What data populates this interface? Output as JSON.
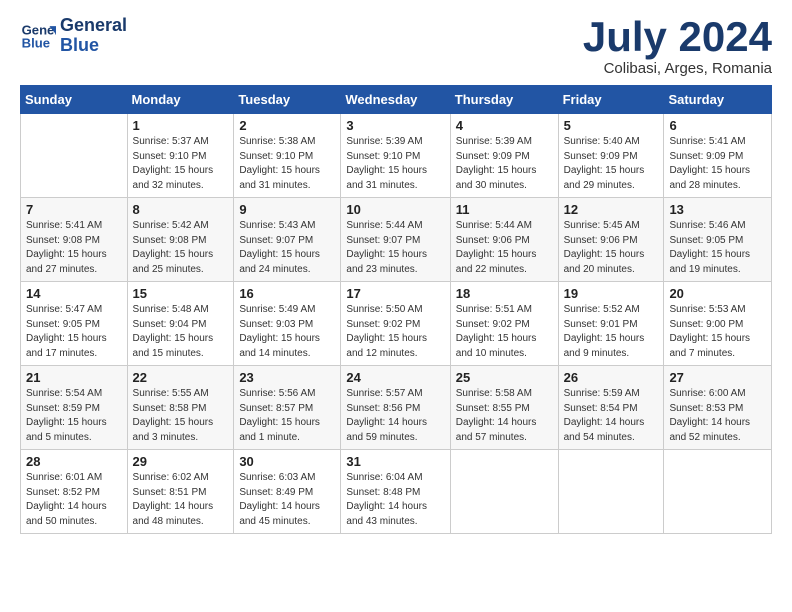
{
  "logo": {
    "line1": "General",
    "line2": "Blue"
  },
  "title": "July 2024",
  "subtitle": "Colibasi, Arges, Romania",
  "weekdays": [
    "Sunday",
    "Monday",
    "Tuesday",
    "Wednesday",
    "Thursday",
    "Friday",
    "Saturday"
  ],
  "weeks": [
    [
      {
        "day": "",
        "info": ""
      },
      {
        "day": "1",
        "info": "Sunrise: 5:37 AM\nSunset: 9:10 PM\nDaylight: 15 hours\nand 32 minutes."
      },
      {
        "day": "2",
        "info": "Sunrise: 5:38 AM\nSunset: 9:10 PM\nDaylight: 15 hours\nand 31 minutes."
      },
      {
        "day": "3",
        "info": "Sunrise: 5:39 AM\nSunset: 9:10 PM\nDaylight: 15 hours\nand 31 minutes."
      },
      {
        "day": "4",
        "info": "Sunrise: 5:39 AM\nSunset: 9:09 PM\nDaylight: 15 hours\nand 30 minutes."
      },
      {
        "day": "5",
        "info": "Sunrise: 5:40 AM\nSunset: 9:09 PM\nDaylight: 15 hours\nand 29 minutes."
      },
      {
        "day": "6",
        "info": "Sunrise: 5:41 AM\nSunset: 9:09 PM\nDaylight: 15 hours\nand 28 minutes."
      }
    ],
    [
      {
        "day": "7",
        "info": "Sunrise: 5:41 AM\nSunset: 9:08 PM\nDaylight: 15 hours\nand 27 minutes."
      },
      {
        "day": "8",
        "info": "Sunrise: 5:42 AM\nSunset: 9:08 PM\nDaylight: 15 hours\nand 25 minutes."
      },
      {
        "day": "9",
        "info": "Sunrise: 5:43 AM\nSunset: 9:07 PM\nDaylight: 15 hours\nand 24 minutes."
      },
      {
        "day": "10",
        "info": "Sunrise: 5:44 AM\nSunset: 9:07 PM\nDaylight: 15 hours\nand 23 minutes."
      },
      {
        "day": "11",
        "info": "Sunrise: 5:44 AM\nSunset: 9:06 PM\nDaylight: 15 hours\nand 22 minutes."
      },
      {
        "day": "12",
        "info": "Sunrise: 5:45 AM\nSunset: 9:06 PM\nDaylight: 15 hours\nand 20 minutes."
      },
      {
        "day": "13",
        "info": "Sunrise: 5:46 AM\nSunset: 9:05 PM\nDaylight: 15 hours\nand 19 minutes."
      }
    ],
    [
      {
        "day": "14",
        "info": "Sunrise: 5:47 AM\nSunset: 9:05 PM\nDaylight: 15 hours\nand 17 minutes."
      },
      {
        "day": "15",
        "info": "Sunrise: 5:48 AM\nSunset: 9:04 PM\nDaylight: 15 hours\nand 15 minutes."
      },
      {
        "day": "16",
        "info": "Sunrise: 5:49 AM\nSunset: 9:03 PM\nDaylight: 15 hours\nand 14 minutes."
      },
      {
        "day": "17",
        "info": "Sunrise: 5:50 AM\nSunset: 9:02 PM\nDaylight: 15 hours\nand 12 minutes."
      },
      {
        "day": "18",
        "info": "Sunrise: 5:51 AM\nSunset: 9:02 PM\nDaylight: 15 hours\nand 10 minutes."
      },
      {
        "day": "19",
        "info": "Sunrise: 5:52 AM\nSunset: 9:01 PM\nDaylight: 15 hours\nand 9 minutes."
      },
      {
        "day": "20",
        "info": "Sunrise: 5:53 AM\nSunset: 9:00 PM\nDaylight: 15 hours\nand 7 minutes."
      }
    ],
    [
      {
        "day": "21",
        "info": "Sunrise: 5:54 AM\nSunset: 8:59 PM\nDaylight: 15 hours\nand 5 minutes."
      },
      {
        "day": "22",
        "info": "Sunrise: 5:55 AM\nSunset: 8:58 PM\nDaylight: 15 hours\nand 3 minutes."
      },
      {
        "day": "23",
        "info": "Sunrise: 5:56 AM\nSunset: 8:57 PM\nDaylight: 15 hours\nand 1 minute."
      },
      {
        "day": "24",
        "info": "Sunrise: 5:57 AM\nSunset: 8:56 PM\nDaylight: 14 hours\nand 59 minutes."
      },
      {
        "day": "25",
        "info": "Sunrise: 5:58 AM\nSunset: 8:55 PM\nDaylight: 14 hours\nand 57 minutes."
      },
      {
        "day": "26",
        "info": "Sunrise: 5:59 AM\nSunset: 8:54 PM\nDaylight: 14 hours\nand 54 minutes."
      },
      {
        "day": "27",
        "info": "Sunrise: 6:00 AM\nSunset: 8:53 PM\nDaylight: 14 hours\nand 52 minutes."
      }
    ],
    [
      {
        "day": "28",
        "info": "Sunrise: 6:01 AM\nSunset: 8:52 PM\nDaylight: 14 hours\nand 50 minutes."
      },
      {
        "day": "29",
        "info": "Sunrise: 6:02 AM\nSunset: 8:51 PM\nDaylight: 14 hours\nand 48 minutes."
      },
      {
        "day": "30",
        "info": "Sunrise: 6:03 AM\nSunset: 8:49 PM\nDaylight: 14 hours\nand 45 minutes."
      },
      {
        "day": "31",
        "info": "Sunrise: 6:04 AM\nSunset: 8:48 PM\nDaylight: 14 hours\nand 43 minutes."
      },
      {
        "day": "",
        "info": ""
      },
      {
        "day": "",
        "info": ""
      },
      {
        "day": "",
        "info": ""
      }
    ]
  ]
}
